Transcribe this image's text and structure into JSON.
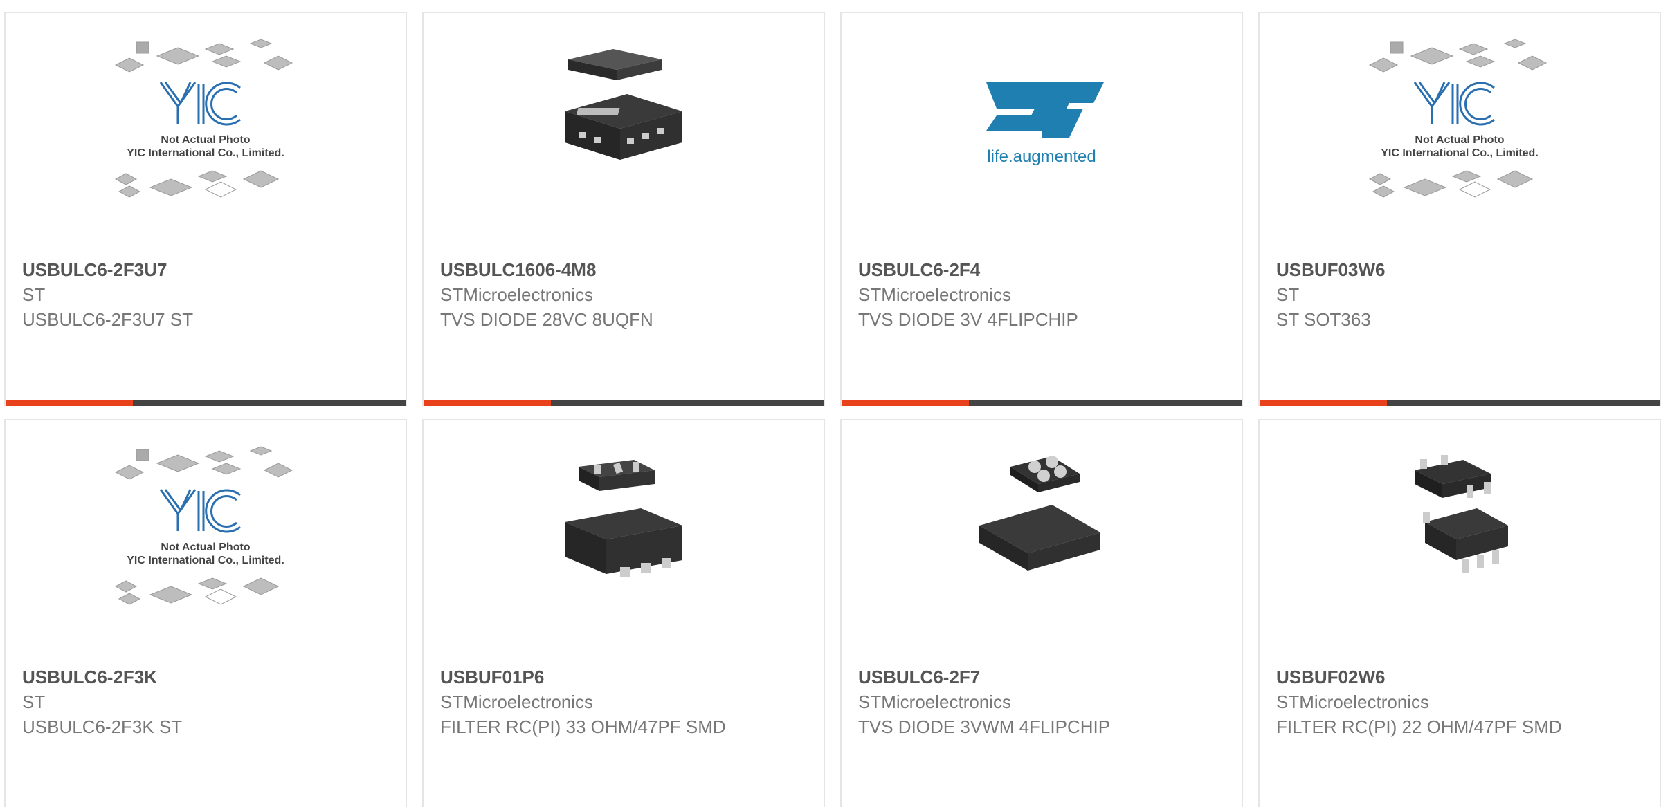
{
  "products": [
    {
      "part": "USBULC6-2F3U7",
      "manufacturer": "ST",
      "description": "USBULC6-2F3U7 ST",
      "image": "yic-placeholder-icon"
    },
    {
      "part": "USBULC1606-4M8",
      "manufacturer": "STMicroelectronics",
      "description": "TVS DIODE 28VC 8UQFN",
      "image": "uqfn-chip-icon"
    },
    {
      "part": "USBULC6-2F4",
      "manufacturer": "STMicroelectronics",
      "description": "TVS DIODE 3V 4FLIPCHIP",
      "image": "st-logo-icon"
    },
    {
      "part": "USBUF03W6",
      "manufacturer": "ST",
      "description": "ST SOT363",
      "image": "yic-placeholder-icon"
    },
    {
      "part": "USBULC6-2F3K",
      "manufacturer": "ST",
      "description": "USBULC6-2F3K ST",
      "image": "yic-placeholder-icon"
    },
    {
      "part": "USBUF01P6",
      "manufacturer": "STMicroelectronics",
      "description": "FILTER RC(PI) 33 OHM/47PF SMD",
      "image": "sot-chip-icon"
    },
    {
      "part": "USBULC6-2F7",
      "manufacturer": "STMicroelectronics",
      "description": "TVS DIODE 3VWM 4FLIPCHIP",
      "image": "flipchip-icon"
    },
    {
      "part": "USBUF02W6",
      "manufacturer": "STMicroelectronics",
      "description": "FILTER RC(PI) 22 OHM/47PF SMD",
      "image": "sot363-chip-icon"
    }
  ],
  "placeholder": {
    "line1": "Not Actual Photo",
    "line2": "YIC International Co., Limited.",
    "logo": "YIC"
  },
  "st_logo": {
    "mark": "ST",
    "tagline": "life.augmented"
  },
  "colors": {
    "accent": "#e8411c",
    "bar": "#444444",
    "st_blue": "#1f7fb0"
  }
}
